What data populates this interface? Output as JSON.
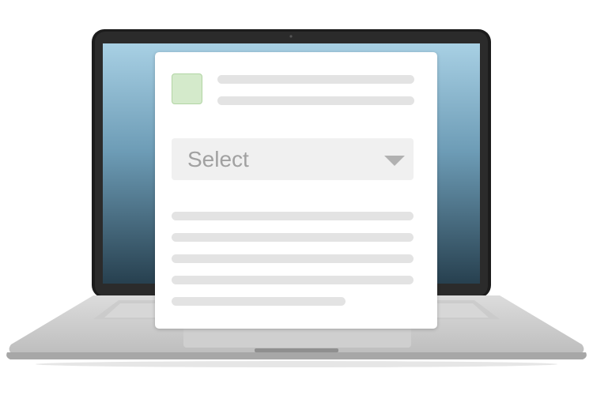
{
  "select_widget": {
    "value": "Select",
    "arrow_icon": "caret-down-icon"
  },
  "colors": {
    "thumbnail": "#d4eacb",
    "placeholder_line": "#e3e3e3",
    "select_background": "#f0f0f0",
    "select_text": "#a1a1a1"
  }
}
